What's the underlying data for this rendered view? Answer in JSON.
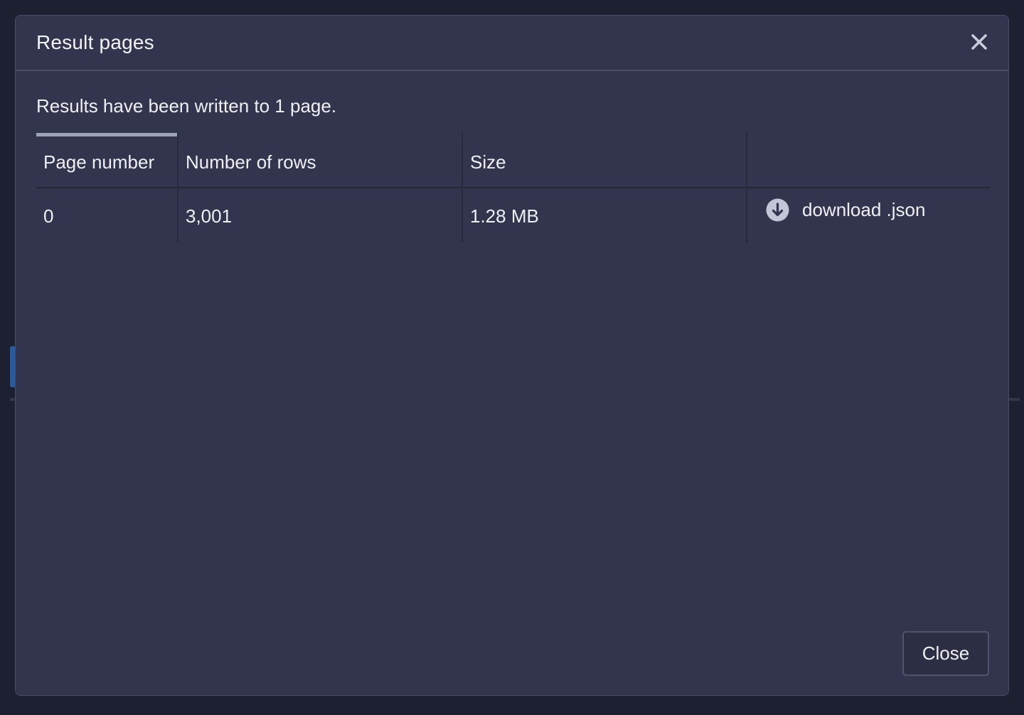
{
  "modal": {
    "title": "Result pages",
    "summary": "Results have been written to 1 page.",
    "close_icon": "close-icon",
    "close_button_label": "Close"
  },
  "table": {
    "columns": [
      "Page number",
      "Number of rows",
      "Size",
      ""
    ],
    "rows": [
      {
        "page_number": "0",
        "number_of_rows": "3,001",
        "size": "1.28 MB",
        "download_label": "download .json",
        "download_icon": "download-circle-icon"
      }
    ]
  },
  "colors": {
    "modal_bg": "#32354d",
    "backdrop": "#1d2030",
    "text": "#eef0f5",
    "accent_indicator": "#9ea3bb"
  }
}
